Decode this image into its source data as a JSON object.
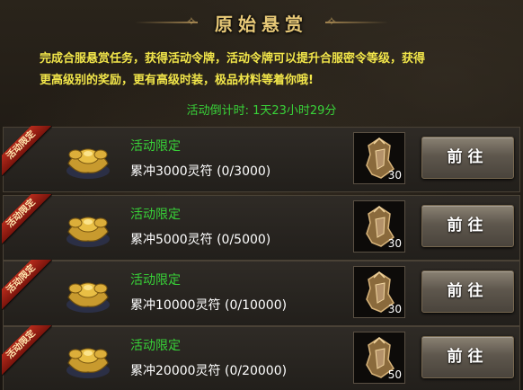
{
  "header": {
    "title": "原始悬赏",
    "description_line1": "完成合服悬赏任务，获得活动令牌，活动令牌可以提升合服密令等级，获得",
    "description_line2": "更高级别的奖励，更有高级时装，极品材料等着你哦!",
    "countdown": "活动倒计时: 1天23小时29分"
  },
  "tasks": [
    {
      "ribbon": "活动限定",
      "label": "活动限定",
      "task": "累冲3000灵符 (0/3000)",
      "reward_count": "30",
      "button": "前往"
    },
    {
      "ribbon": "活动限定",
      "label": "活动限定",
      "task": "累冲5000灵符 (0/5000)",
      "reward_count": "30",
      "button": "前往"
    },
    {
      "ribbon": "活动限定",
      "label": "活动限定",
      "task": "累冲10000灵符 (0/10000)",
      "reward_count": "30",
      "button": "前往"
    },
    {
      "ribbon": "活动限定",
      "label": "活动限定",
      "task": "累冲20000灵符 (0/20000)",
      "reward_count": "50",
      "button": "前往"
    }
  ],
  "colors": {
    "title": "#e8c978",
    "description": "#f2e64a",
    "green": "#38d238",
    "ribbon": "#b72b1c"
  },
  "icons": {
    "task_icon": "gold-ingot-treasure-icon",
    "reward_icon": "token-medallion-icon"
  }
}
